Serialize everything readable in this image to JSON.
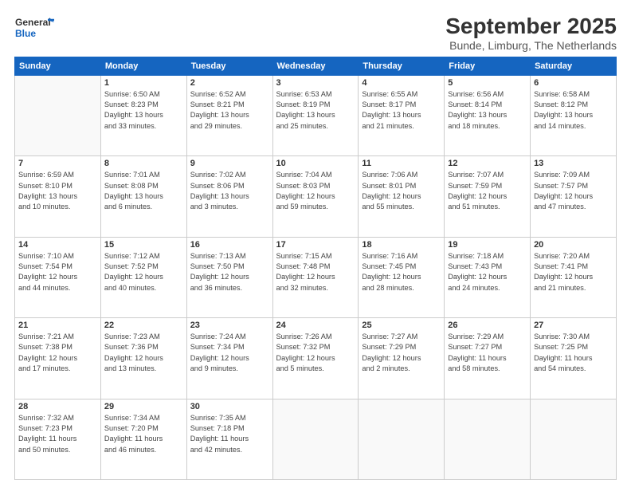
{
  "header": {
    "logo_line1": "General",
    "logo_line2": "Blue",
    "title": "September 2025",
    "subtitle": "Bunde, Limburg, The Netherlands"
  },
  "days_of_week": [
    "Sunday",
    "Monday",
    "Tuesday",
    "Wednesday",
    "Thursday",
    "Friday",
    "Saturday"
  ],
  "weeks": [
    [
      {
        "num": "",
        "info": ""
      },
      {
        "num": "1",
        "info": "Sunrise: 6:50 AM\nSunset: 8:23 PM\nDaylight: 13 hours\nand 33 minutes."
      },
      {
        "num": "2",
        "info": "Sunrise: 6:52 AM\nSunset: 8:21 PM\nDaylight: 13 hours\nand 29 minutes."
      },
      {
        "num": "3",
        "info": "Sunrise: 6:53 AM\nSunset: 8:19 PM\nDaylight: 13 hours\nand 25 minutes."
      },
      {
        "num": "4",
        "info": "Sunrise: 6:55 AM\nSunset: 8:17 PM\nDaylight: 13 hours\nand 21 minutes."
      },
      {
        "num": "5",
        "info": "Sunrise: 6:56 AM\nSunset: 8:14 PM\nDaylight: 13 hours\nand 18 minutes."
      },
      {
        "num": "6",
        "info": "Sunrise: 6:58 AM\nSunset: 8:12 PM\nDaylight: 13 hours\nand 14 minutes."
      }
    ],
    [
      {
        "num": "7",
        "info": "Sunrise: 6:59 AM\nSunset: 8:10 PM\nDaylight: 13 hours\nand 10 minutes."
      },
      {
        "num": "8",
        "info": "Sunrise: 7:01 AM\nSunset: 8:08 PM\nDaylight: 13 hours\nand 6 minutes."
      },
      {
        "num": "9",
        "info": "Sunrise: 7:02 AM\nSunset: 8:06 PM\nDaylight: 13 hours\nand 3 minutes."
      },
      {
        "num": "10",
        "info": "Sunrise: 7:04 AM\nSunset: 8:03 PM\nDaylight: 12 hours\nand 59 minutes."
      },
      {
        "num": "11",
        "info": "Sunrise: 7:06 AM\nSunset: 8:01 PM\nDaylight: 12 hours\nand 55 minutes."
      },
      {
        "num": "12",
        "info": "Sunrise: 7:07 AM\nSunset: 7:59 PM\nDaylight: 12 hours\nand 51 minutes."
      },
      {
        "num": "13",
        "info": "Sunrise: 7:09 AM\nSunset: 7:57 PM\nDaylight: 12 hours\nand 47 minutes."
      }
    ],
    [
      {
        "num": "14",
        "info": "Sunrise: 7:10 AM\nSunset: 7:54 PM\nDaylight: 12 hours\nand 44 minutes."
      },
      {
        "num": "15",
        "info": "Sunrise: 7:12 AM\nSunset: 7:52 PM\nDaylight: 12 hours\nand 40 minutes."
      },
      {
        "num": "16",
        "info": "Sunrise: 7:13 AM\nSunset: 7:50 PM\nDaylight: 12 hours\nand 36 minutes."
      },
      {
        "num": "17",
        "info": "Sunrise: 7:15 AM\nSunset: 7:48 PM\nDaylight: 12 hours\nand 32 minutes."
      },
      {
        "num": "18",
        "info": "Sunrise: 7:16 AM\nSunset: 7:45 PM\nDaylight: 12 hours\nand 28 minutes."
      },
      {
        "num": "19",
        "info": "Sunrise: 7:18 AM\nSunset: 7:43 PM\nDaylight: 12 hours\nand 24 minutes."
      },
      {
        "num": "20",
        "info": "Sunrise: 7:20 AM\nSunset: 7:41 PM\nDaylight: 12 hours\nand 21 minutes."
      }
    ],
    [
      {
        "num": "21",
        "info": "Sunrise: 7:21 AM\nSunset: 7:38 PM\nDaylight: 12 hours\nand 17 minutes."
      },
      {
        "num": "22",
        "info": "Sunrise: 7:23 AM\nSunset: 7:36 PM\nDaylight: 12 hours\nand 13 minutes."
      },
      {
        "num": "23",
        "info": "Sunrise: 7:24 AM\nSunset: 7:34 PM\nDaylight: 12 hours\nand 9 minutes."
      },
      {
        "num": "24",
        "info": "Sunrise: 7:26 AM\nSunset: 7:32 PM\nDaylight: 12 hours\nand 5 minutes."
      },
      {
        "num": "25",
        "info": "Sunrise: 7:27 AM\nSunset: 7:29 PM\nDaylight: 12 hours\nand 2 minutes."
      },
      {
        "num": "26",
        "info": "Sunrise: 7:29 AM\nSunset: 7:27 PM\nDaylight: 11 hours\nand 58 minutes."
      },
      {
        "num": "27",
        "info": "Sunrise: 7:30 AM\nSunset: 7:25 PM\nDaylight: 11 hours\nand 54 minutes."
      }
    ],
    [
      {
        "num": "28",
        "info": "Sunrise: 7:32 AM\nSunset: 7:23 PM\nDaylight: 11 hours\nand 50 minutes."
      },
      {
        "num": "29",
        "info": "Sunrise: 7:34 AM\nSunset: 7:20 PM\nDaylight: 11 hours\nand 46 minutes."
      },
      {
        "num": "30",
        "info": "Sunrise: 7:35 AM\nSunset: 7:18 PM\nDaylight: 11 hours\nand 42 minutes."
      },
      {
        "num": "",
        "info": ""
      },
      {
        "num": "",
        "info": ""
      },
      {
        "num": "",
        "info": ""
      },
      {
        "num": "",
        "info": ""
      }
    ]
  ]
}
